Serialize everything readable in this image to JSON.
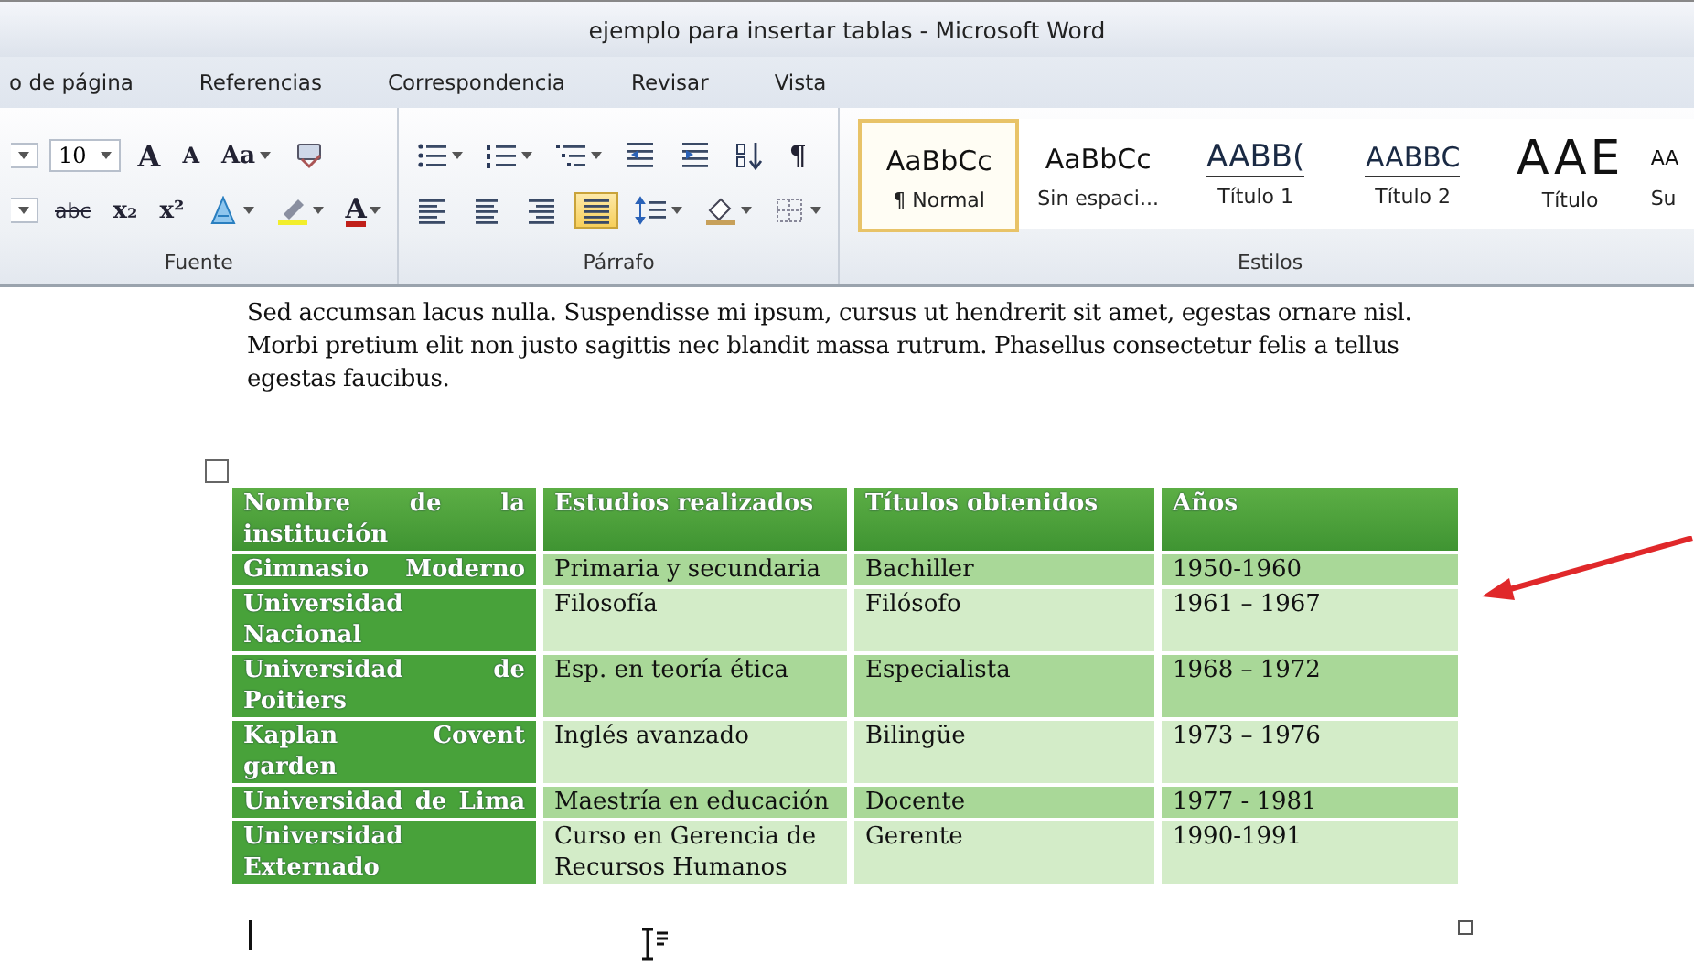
{
  "window": {
    "title": "ejemplo para insertar tablas - Microsoft Word"
  },
  "tabs": [
    {
      "label": "o de página",
      "selected": false
    },
    {
      "label": "Referencias",
      "selected": false
    },
    {
      "label": "Correspondencia",
      "selected": false
    },
    {
      "label": "Revisar",
      "selected": false
    },
    {
      "label": "Vista",
      "selected": false
    }
  ],
  "ribbon": {
    "font_group": {
      "label": "Fuente",
      "size": "10",
      "row1": [
        {
          "kind": "grow",
          "label": "A",
          "dropdown": false,
          "selected": false
        },
        {
          "kind": "shrink",
          "label": "A",
          "dropdown": false,
          "selected": false
        },
        {
          "kind": "case",
          "label": "Aa",
          "dropdown": true,
          "selected": false
        },
        {
          "kind": "clear-format",
          "dropdown": false,
          "selected": false
        }
      ],
      "row2": [
        {
          "kind": "strike",
          "label": "abc",
          "dropdown": false,
          "selected": false
        },
        {
          "kind": "sub",
          "label": "x₂",
          "dropdown": false,
          "selected": false
        },
        {
          "kind": "sup",
          "label": "x²",
          "dropdown": false,
          "selected": false
        },
        {
          "kind": "text-effects",
          "dropdown": true,
          "selected": false
        },
        {
          "kind": "highlight",
          "dropdown": true,
          "selected": false
        },
        {
          "kind": "font-color",
          "label": "A",
          "dropdown": true,
          "selected": false
        }
      ]
    },
    "paragraph_group": {
      "label": "Párrafo",
      "row1": [
        {
          "kind": "bullets",
          "dropdown": true,
          "selected": false
        },
        {
          "kind": "numbering",
          "dropdown": true,
          "selected": false
        },
        {
          "kind": "multilevel",
          "dropdown": true,
          "selected": false
        },
        {
          "kind": "indent-dec",
          "dropdown": false,
          "selected": false
        },
        {
          "kind": "indent-inc",
          "dropdown": false,
          "selected": false
        },
        {
          "kind": "sort",
          "dropdown": false,
          "selected": false
        },
        {
          "kind": "pilcrow",
          "label": "¶",
          "dropdown": false,
          "selected": false
        }
      ],
      "row2": [
        {
          "kind": "align-left",
          "dropdown": false,
          "selected": false
        },
        {
          "kind": "align-center",
          "dropdown": false,
          "selected": false
        },
        {
          "kind": "align-right",
          "dropdown": false,
          "selected": false
        },
        {
          "kind": "justify",
          "dropdown": false,
          "selected": true
        },
        {
          "kind": "line-spacing",
          "dropdown": true,
          "selected": false
        },
        {
          "kind": "shading",
          "dropdown": true,
          "selected": false
        },
        {
          "kind": "borders",
          "dropdown": true,
          "selected": false
        }
      ]
    },
    "styles_group": {
      "label": "Estilos",
      "styles": [
        {
          "kind": "normal",
          "sample": "AaBbCc",
          "name": "¶ Normal",
          "selected": true
        },
        {
          "kind": "nospacing",
          "sample": "AaBbCc",
          "name": "Sin espaci...",
          "selected": false
        },
        {
          "kind": "heading1",
          "sample": "AABB(",
          "name": "Título 1",
          "selected": false
        },
        {
          "kind": "heading2",
          "sample": "AABBC",
          "name": "Título 2",
          "selected": false
        },
        {
          "kind": "title",
          "sample": "AAE",
          "name": "Título",
          "selected": false
        },
        {
          "kind": "subtitle",
          "sample": "AA",
          "name": "Su",
          "selected": false
        }
      ]
    }
  },
  "document": {
    "paragraph": "Sed accumsan lacus nulla. Suspendisse mi ipsum, cursus ut hendrerit sit amet, egestas ornare nisl. Morbi pretium elit non justo sagittis nec blandit massa rutrum. Phasellus consectetur felis a tellus egestas faucibus.",
    "table": {
      "columns": [
        "Nombre de la institución",
        "Estudios realizados",
        "Títulos obtenidos",
        "Años"
      ],
      "rows": [
        [
          "Gimnasio Moderno",
          "Primaria y secundaria",
          "Bachiller",
          "1950-1960"
        ],
        [
          "Universidad Nacional",
          "Filosofía",
          "Filósofo",
          "1961 – 1967"
        ],
        [
          "Universidad de Poitiers",
          "Esp. en teoría ética",
          "Especialista",
          "1968 – 1972"
        ],
        [
          "Kaplan Covent garden",
          "Inglés avanzado",
          "Bilingüe",
          "1973 – 1976"
        ],
        [
          "Universidad de Lima",
          "Maestría en educación",
          "Docente",
          "1977 - 1981"
        ],
        [
          "Universidad Externado",
          "Curso en Gerencia de Recursos Humanos",
          "Gerente",
          "1990-1991"
        ]
      ]
    }
  }
}
